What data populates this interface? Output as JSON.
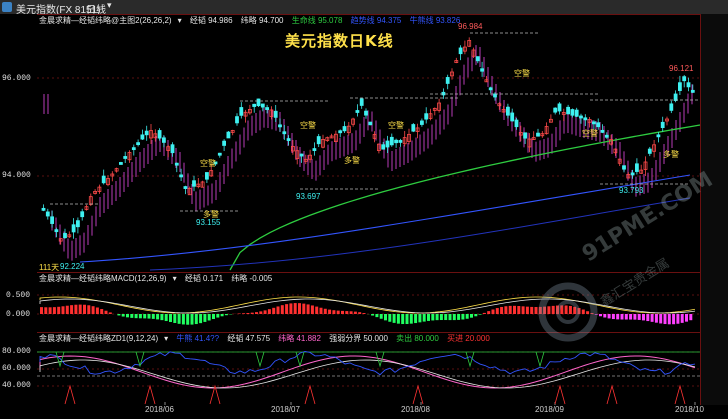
{
  "window": {
    "title": "美元指数(FX 8151)",
    "period": "日线"
  },
  "main_panel": {
    "title": "美元指数日K线",
    "indicator_name": "金晨求精—经韬纬略@主图2(26,26,2)",
    "legend": [
      {
        "label": "经韬 94.986",
        "color": "#e6e6e6"
      },
      {
        "label": "纬略 94.700",
        "color": "#e6e6e6"
      },
      {
        "label": "生命线 95.078",
        "color": "#2ecc40"
      },
      {
        "label": "趋势线 94.375",
        "color": "#3355ff"
      },
      {
        "label": "牛熊线 93.826",
        "color": "#3355ff"
      }
    ],
    "price_ticks": [
      "96.000",
      "94.000"
    ],
    "annotations": {
      "high_label": "96.984",
      "right_high_label": "96.121",
      "low_labels": [
        "93.155",
        "93.697",
        "93.793",
        "92.224"
      ],
      "day_count": "111天",
      "signals": [
        "空警",
        "多警",
        "空警",
        "空警",
        "空警",
        "多警",
        "空警",
        "多警"
      ]
    }
  },
  "macd_panel": {
    "indicator_name": "金晨求精—经韬纬略MACD(12,26,9)",
    "legend": [
      {
        "label": "经韬 0.171",
        "color": "#e6e6e6"
      },
      {
        "label": "纬略 -0.005",
        "color": "#e6e6e6"
      }
    ],
    "ticks": [
      "0.500",
      "0.000"
    ]
  },
  "kdj_panel": {
    "indicator_name": "金晨求精—经韬纬略ZD1(9,12,24)",
    "legend": [
      {
        "label": "牛熊 41.4??",
        "color": "#3355ff"
      },
      {
        "label": "经韬 47.575",
        "color": "#e6e6e6"
      },
      {
        "label": "纬略 41.882",
        "color": "#ff66cc"
      },
      {
        "label": "强弱分界 50.000",
        "color": "#e6e6e6"
      },
      {
        "label": "卖出 80.000",
        "color": "#2ecc40"
      },
      {
        "label": "买进 20.000",
        "color": "#ff3333"
      }
    ],
    "ticks": [
      "80.000",
      "60.000",
      "40.000"
    ]
  },
  "x_axis": {
    "labels": [
      "2018/06",
      "2018/07",
      "2018/08",
      "2018/09",
      "2018/10"
    ]
  },
  "colors": {
    "up": "#ff4a4a",
    "down": "#3ef0f0",
    "life_line": "#2ecc40",
    "trend_line": "#3355ff",
    "ribbon": "#c040c0",
    "title": "#ffe14a"
  },
  "watermark": {
    "brand": "91PME.COM",
    "slogan": "鑫汇宝贵金属"
  }
}
